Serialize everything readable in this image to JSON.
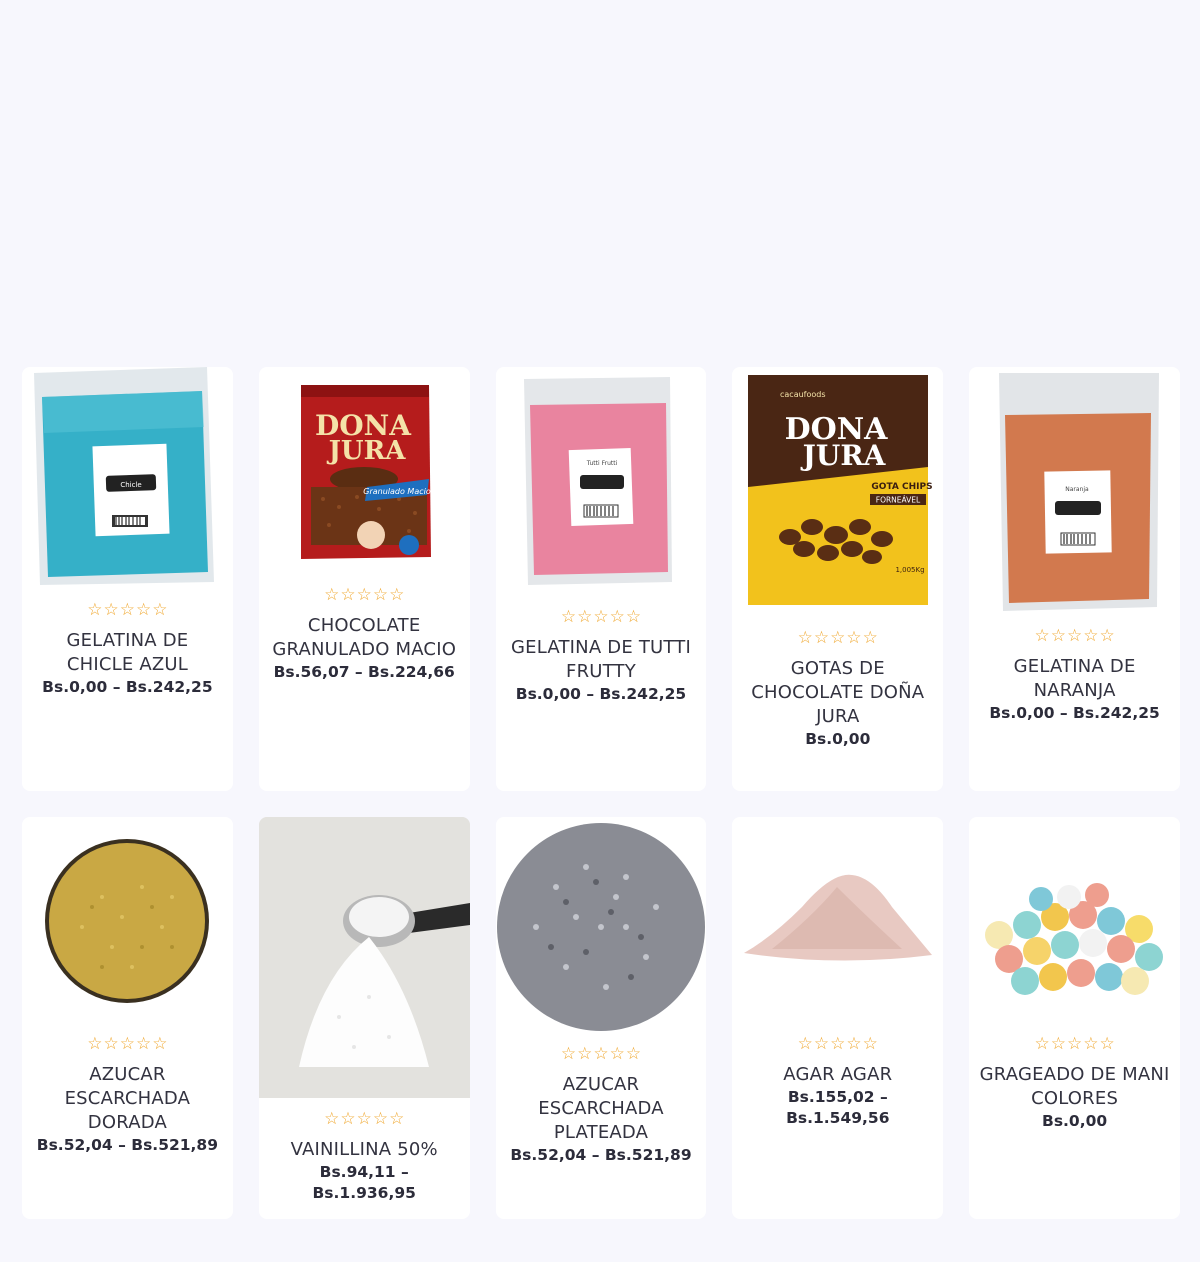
{
  "products": [
    {
      "title": "GELATINA DE CHICLE AZUL",
      "price": "Bs.0,00 – Bs.242,25",
      "image": "blue-powder-bag"
    },
    {
      "title": "CHOCOLATE GRANULADO MACIO",
      "price": "Bs.56,07 – Bs.224,66",
      "image": "dona-jura-sprinkles-bag"
    },
    {
      "title": "GELATINA DE TUTTI FRUTTY",
      "price": "Bs.0,00 – Bs.242,25",
      "image": "pink-powder-bag"
    },
    {
      "title": "GOTAS DE CHOCOLATE DOÑA JURA",
      "price": "Bs.0,00",
      "image": "dona-jura-chips-bag"
    },
    {
      "title": "GELATINA DE NARANJA",
      "price": "Bs.0,00 – Bs.242,25",
      "image": "orange-powder-bag"
    },
    {
      "title": "AZUCAR ESCARCHADA DORADA",
      "price": "Bs.52,04 – Bs.521,89",
      "image": "gold-sugar-bowl"
    },
    {
      "title": "VAINILLINA 50%",
      "price": "Bs.94,11 – Bs.1.936,95",
      "image": "vanillin-spoon"
    },
    {
      "title": "AZUCAR ESCARCHADA PLATEADA",
      "price": "Bs.52,04 – Bs.521,89",
      "image": "silver-sugar-pile"
    },
    {
      "title": "AGAR AGAR",
      "price": "Bs.155,02 – Bs.1.549,56",
      "image": "agar-powder-pile"
    },
    {
      "title": "GRAGEADO DE MANI COLORES",
      "price": "Bs.0,00",
      "image": "colored-candy-balls"
    }
  ],
  "brand": {
    "dona_jura_line1": "DONA",
    "dona_jura_line2": "JURA",
    "granulado_label": "Granulado Macio",
    "gota_chips": "GOTA CHIPS",
    "forneavel": "FORNEÁVEL",
    "cacau_foods": "cacaufoods",
    "weight": "1,005Kg",
    "tag_blue": "Chicle",
    "tag_pink": "Tutti Frutti",
    "tag_orange": "Naranja"
  },
  "colors": {
    "star": "#f0a830",
    "background": "#f7f7fd",
    "card": "#ffffff"
  }
}
